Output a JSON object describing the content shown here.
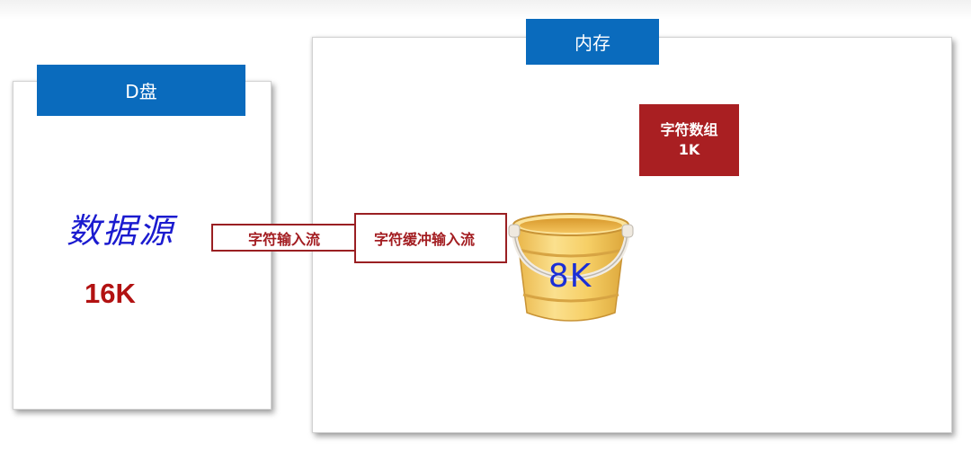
{
  "disk": {
    "title": "D盘",
    "source_label": "数据源",
    "size": "16K"
  },
  "memory": {
    "title": "内存"
  },
  "streams": {
    "char_input": "字符输入流",
    "buffered_char_input": "字符缓冲输入流"
  },
  "char_array": {
    "label": "字符数组",
    "size": "1K"
  },
  "buffer": {
    "size": "8K",
    "icon": "bucket-icon"
  },
  "colors": {
    "tab_blue": "#0a6bbd",
    "accent_red": "#a91f22",
    "handwriting_blue": "#1b1bcf"
  }
}
